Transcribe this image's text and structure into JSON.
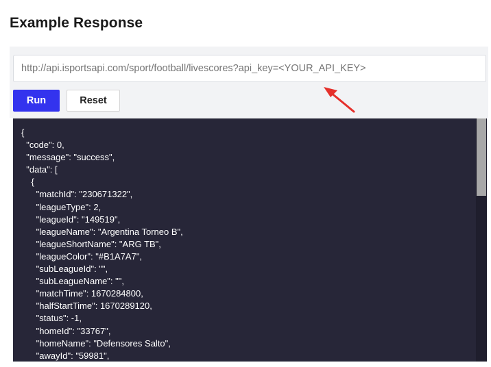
{
  "heading": "Example Response",
  "request": {
    "url_placeholder": "http://api.isportsapi.com/sport/football/livescores?api_key=<YOUR_API_KEY>",
    "run_label": "Run",
    "reset_label": "Reset"
  },
  "colors": {
    "run_button": "#3333ee",
    "code_background": "#272638",
    "arrow": "#e5302b"
  },
  "arrow_icon": "red-arrow-icon",
  "response_lines": [
    "{",
    "  \"code\": 0,",
    "  \"message\": \"success\",",
    "  \"data\": [",
    "    {",
    "      \"matchId\": \"230671322\",",
    "      \"leagueType\": 2,",
    "      \"leagueId\": \"149519\",",
    "      \"leagueName\": \"Argentina Torneo B\",",
    "      \"leagueShortName\": \"ARG TB\",",
    "      \"leagueColor\": \"#B1A7A7\",",
    "      \"subLeagueId\": \"\",",
    "      \"subLeagueName\": \"\",",
    "      \"matchTime\": 1670284800,",
    "      \"halfStartTime\": 1670289120,",
    "      \"status\": -1,",
    "      \"homeId\": \"33767\",",
    "      \"homeName\": \"Defensores Salto\",",
    "      \"awayId\": \"59981\","
  ]
}
